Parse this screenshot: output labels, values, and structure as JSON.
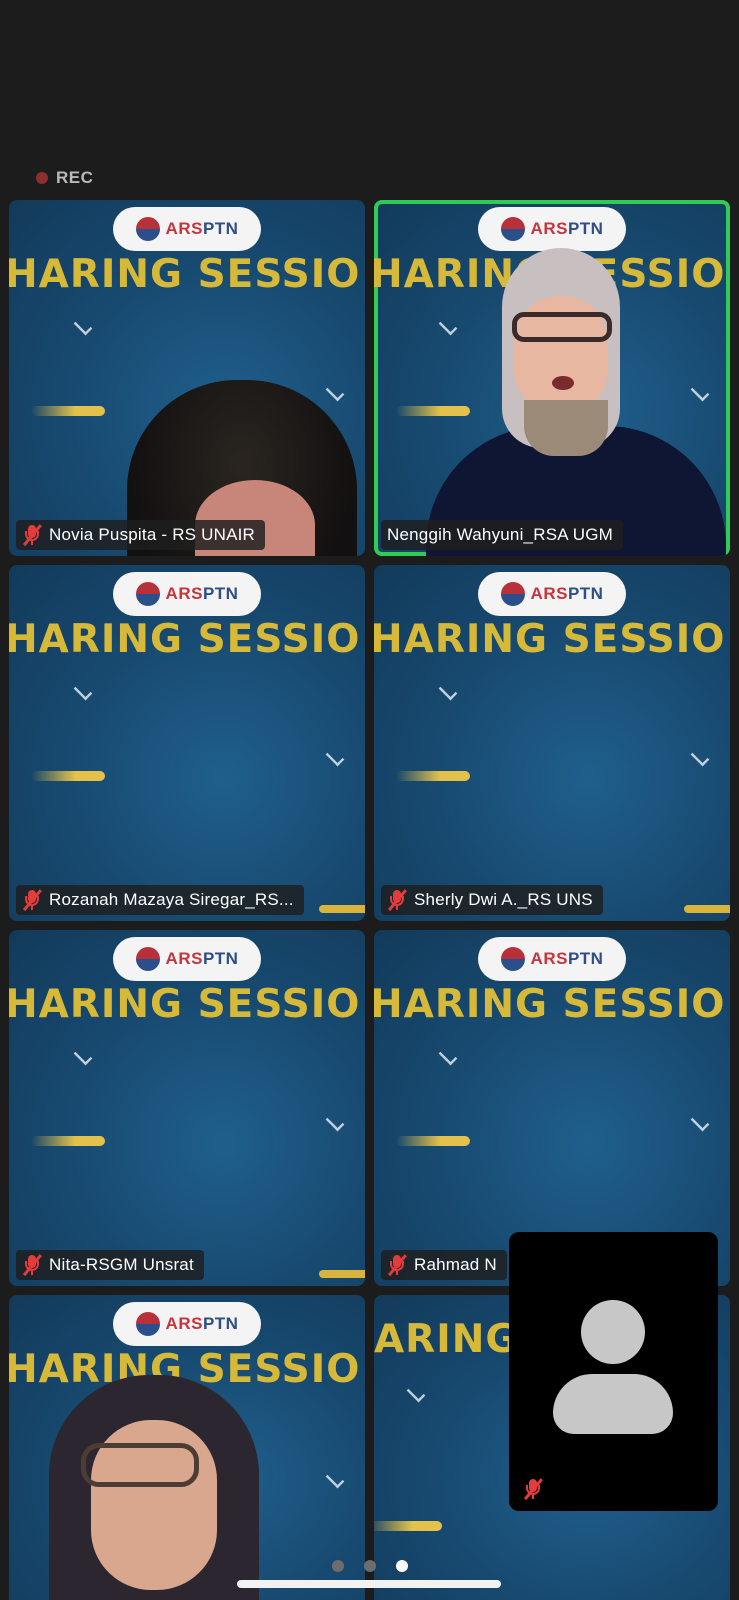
{
  "recording": {
    "label": "REC"
  },
  "shared_background": {
    "logo_text_a": "ARS",
    "logo_text_b": "PTN",
    "banner_text": "HARING SESSIO",
    "banner_text_shifted": "ARING S"
  },
  "participants": [
    {
      "name": "Novia Puspita - RS UNAIR",
      "muted": true,
      "active_speaker": false
    },
    {
      "name": "Nenggih Wahyuni_RSA UGM",
      "muted": false,
      "active_speaker": true
    },
    {
      "name": "Rozanah Mazaya Siregar_RS...",
      "muted": true,
      "active_speaker": false
    },
    {
      "name": "Sherly Dwi A._RS UNS",
      "muted": true,
      "active_speaker": false
    },
    {
      "name": "Nita-RSGM Unsrat",
      "muted": true,
      "active_speaker": false
    },
    {
      "name": "Rahmad N",
      "muted": true,
      "active_speaker": false
    },
    {
      "name": "",
      "muted": false,
      "active_speaker": false
    },
    {
      "name": "",
      "muted": false,
      "active_speaker": false
    }
  ],
  "self_view": {
    "video_on": false,
    "muted": true
  },
  "pagination": {
    "pages": 3,
    "current": 3
  },
  "colors": {
    "active_border": "#2ecc55",
    "mute_red": "#e43b3b",
    "banner_gold": "#d7b93a"
  },
  "icons": {
    "mute": "mic-off-icon",
    "avatar": "person-avatar-icon"
  }
}
